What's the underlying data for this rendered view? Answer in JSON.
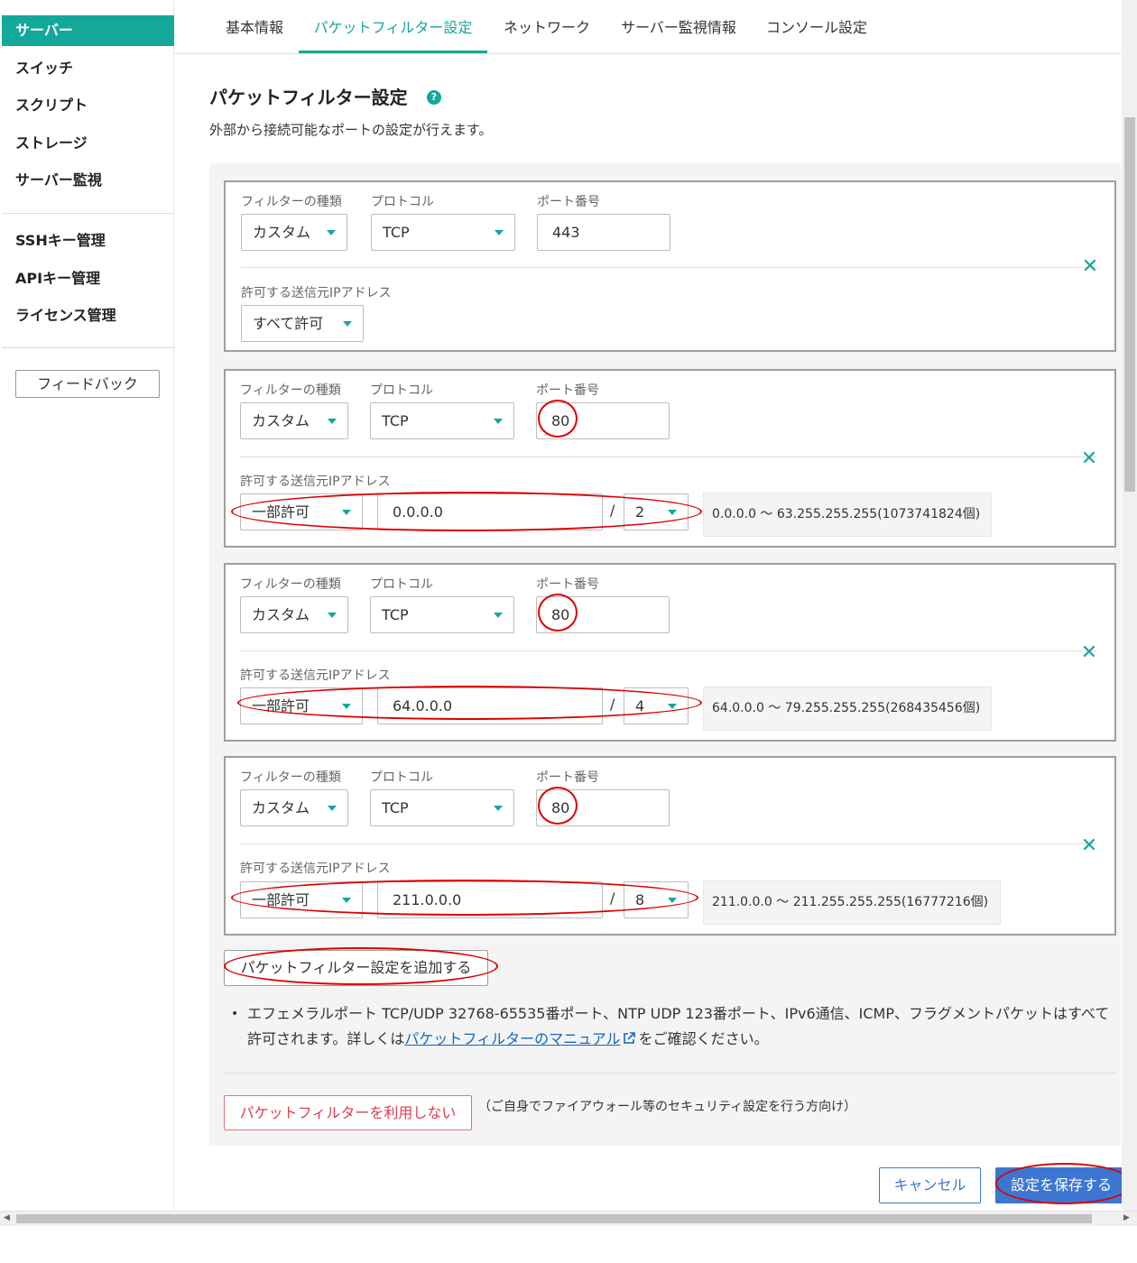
{
  "sidebar": {
    "items": [
      {
        "label": "サーバー",
        "active": true
      },
      {
        "label": "スイッチ"
      },
      {
        "label": "スクリプト"
      },
      {
        "label": "ストレージ"
      },
      {
        "label": "サーバー監視"
      },
      {
        "label": "SSHキー管理"
      },
      {
        "label": "APIキー管理"
      },
      {
        "label": "ライセンス管理"
      }
    ],
    "feedback_label": "フィードバック"
  },
  "tabs": [
    {
      "label": "基本情報"
    },
    {
      "label": "パケットフィルター設定",
      "active": true
    },
    {
      "label": "ネットワーク"
    },
    {
      "label": "サーバー監視情報"
    },
    {
      "label": "コンソール設定"
    }
  ],
  "section": {
    "title": "パケットフィルター設定",
    "help_icon": "?",
    "description": "外部から接続可能なポートの設定が行えます。"
  },
  "labels": {
    "filter_type": "フィルターの種類",
    "protocol": "プロトコル",
    "port": "ポート番号",
    "source_ip": "許可する送信元IPアドレス",
    "slash": "/",
    "remove_icon": "✕"
  },
  "rules": [
    {
      "filter_type": "カスタム",
      "protocol": "TCP",
      "port": "443",
      "source_mode": "すべて許可"
    },
    {
      "filter_type": "カスタム",
      "protocol": "TCP",
      "port": "80",
      "source_mode": "一部許可",
      "ip": "0.0.0.0",
      "prefix": "2",
      "range": "0.0.0.0 〜 63.255.255.255(1073741824個)"
    },
    {
      "filter_type": "カスタム",
      "protocol": "TCP",
      "port": "80",
      "source_mode": "一部許可",
      "ip": "64.0.0.0",
      "prefix": "4",
      "range": "64.0.0.0 〜 79.255.255.255(268435456個)"
    },
    {
      "filter_type": "カスタム",
      "protocol": "TCP",
      "port": "80",
      "source_mode": "一部許可",
      "ip": "211.0.0.0",
      "prefix": "8",
      "range": "211.0.0.0 〜 211.255.255.255(16777216個)"
    }
  ],
  "add_button": "パケットフィルター設定を追加する",
  "note": {
    "bullet": "•",
    "before": "エフェメラルポート TCP/UDP 32768-65535番ポート、NTP UDP 123番ポート、IPv6通信、ICMP、フラグメントパケットはすべて許可されます。詳しくは",
    "link": "パケットフィルターのマニュアル",
    "after": "をご確認ください。"
  },
  "no_filter": {
    "button": "パケットフィルターを利用しない",
    "note": "（ご自身でファイアウォール等のセキュリティ設定を行う方向け）"
  },
  "footer": {
    "cancel": "キャンセル",
    "save": "設定を保存する"
  },
  "colors": {
    "accent": "#14a89a",
    "primary_button": "#3d76d1",
    "danger": "#dd3e50",
    "annotation_ring": "#dd0000"
  }
}
